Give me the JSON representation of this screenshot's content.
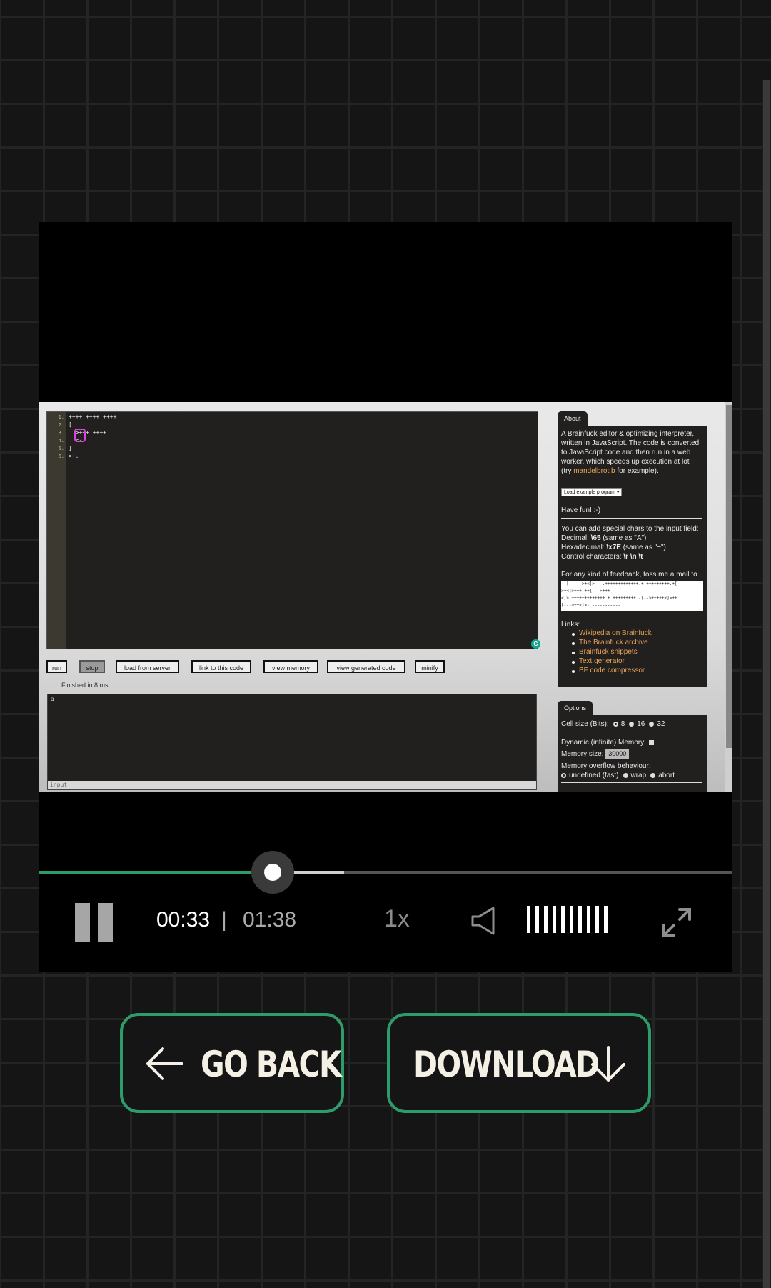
{
  "editor": {
    "line_numbers": [
      "1.",
      "2.",
      "3.",
      "4.",
      "5.",
      "6."
    ],
    "lines": [
      "++++ ++++ ++++",
      "[",
      "  >+++ ++++",
      "  <-",
      "]",
      ">+."
    ]
  },
  "video_toolbar": {
    "run": "run",
    "stop": "stop",
    "load_from_server": "load from server",
    "link_to_code": "link to this code",
    "view_memory": "view memory",
    "view_generated_code": "view generated code",
    "minify": "minify"
  },
  "status": "Finished in 8 ms.",
  "output": {
    "text": "a",
    "input_label": "input"
  },
  "about": {
    "tab": "About",
    "desc1": "A Brainfuck editor & optimizing interpreter,",
    "desc2": "written in JavaScript. The code is converted",
    "desc3": "to JavaScript code and then run in a web",
    "desc4": "worker, which speeds up execution at lot",
    "desc5_pre": "(try ",
    "desc5_link": "mandelbrot.b",
    "desc5_post": " for example).",
    "example_select": "Load example program ▾",
    "have_fun": "Have fun! :-)",
    "special1": "You can add special chars to the input field:",
    "special2_label": "Decimal: ",
    "special2_code": "\\65",
    "special2_rest": " (same as \"A\")",
    "special3_label": "Hexadecimal: ",
    "special3_code": "\\x7E",
    "special3_rest": " (same as \"~\")",
    "special4_label": "Control characters: ",
    "special4_code": "\\r \\n \\t",
    "feedback": "For any kind of feedback, toss me a mail to",
    "bf_lines": [
      "--[----->+<]>---.+++++++++++++.+.+++++++++.+[--",
      ">+<]>+++.++[--->+++",
      "<]>.+++++++++++++.+.+++++++++.-[-->+++++<]>++.",
      "[--->++<]>-.-----------."
    ],
    "links_title": "Links:",
    "links": [
      "Wikipedia on Brainfuck",
      "The Brainfuck archive",
      "Brainfuck snippets",
      "Text generator",
      "BF code compressor"
    ]
  },
  "options": {
    "tab": "Options",
    "cell_size_label": "Cell size (Bits):",
    "cell_sizes": [
      "8",
      "16",
      "32"
    ],
    "dynamic_label": "Dynamic (infinite) Memory:",
    "memory_size_label": "Memory size:",
    "memory_size_value": "30000",
    "overflow_label": "Memory overflow behaviour:",
    "overflow_options": [
      "undefined (fast)",
      "wrap",
      "abort"
    ]
  },
  "player": {
    "current_time": "00:33",
    "separator": "|",
    "total_time": "01:38",
    "speed": "1x",
    "progress": 0.337,
    "buffered": 0.44,
    "volume_bars": 10
  },
  "actions": {
    "go_back": "GO BACK",
    "download": "DOWNLOAD"
  },
  "icons": [
    "pause-icon",
    "speaker-icon",
    "fullscreen-icon",
    "arrow-left-icon",
    "arrow-down-icon",
    "grammarly-icon"
  ],
  "colors": {
    "accent": "#2e9c6a",
    "link": "#e9a355",
    "cursor": "#e040e0"
  }
}
